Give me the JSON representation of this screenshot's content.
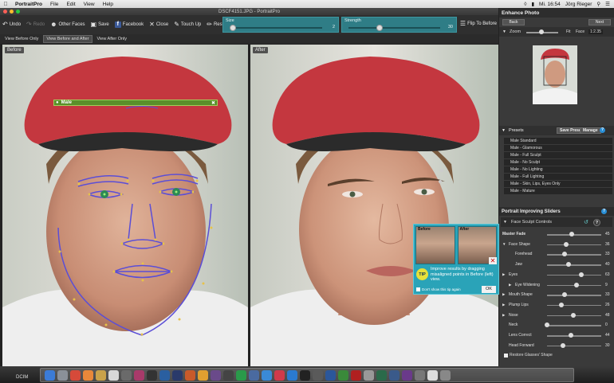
{
  "menubar": {
    "app": "PortraitPro",
    "menus": [
      "File",
      "Edit",
      "View",
      "Help"
    ],
    "clock": "Mi. 16:54",
    "user": "Jörg Rieger"
  },
  "window": {
    "title": "DSCF4151.JPG - PortraitPro"
  },
  "toolbar": {
    "undo": "Undo",
    "redo": "Redo",
    "other_faces": "Other Faces",
    "save": "Save",
    "facebook": "Facebook",
    "close": "Close",
    "touch_up": "Touch Up",
    "restore": "Restore",
    "size": {
      "label": "Size",
      "value": "2",
      "fraction": 0.03
    },
    "strength": {
      "label": "Strength",
      "value": "30",
      "fraction": 0.33
    },
    "flip": "Flip To Before"
  },
  "view_tabs": [
    "View Before Only",
    "View Before and After",
    "View After Only"
  ],
  "view_tab_active": 1,
  "before_label": "Before",
  "after_label": "After",
  "face_label": "Male",
  "tip": {
    "before": "Before",
    "after": "After",
    "badge": "TIP",
    "message": "Improve results by dragging misaligned points in Before (left) view.",
    "dont_show": "Don't show this tip again",
    "ok": "OK"
  },
  "enhance": {
    "title": "Enhance Photo",
    "back": "Back",
    "next": "Next",
    "zoom_label": "Zoom",
    "fit": "Fit",
    "face": "Face",
    "zoom_value": "1:2.35"
  },
  "presets": {
    "title": "Presets",
    "save": "Save Preset",
    "manage": "Manage",
    "items": [
      "Male Standard",
      "Male - Glamorous",
      "Male - Full Sculpt",
      "Male - No Sculpt",
      "Male - No Lighting",
      "Male - Full Lighting",
      "Male - Skin, Lips, Eyes Only",
      "Male - Mature"
    ]
  },
  "sliders": {
    "title": "Portrait Improving Sliders",
    "group": "Face Sculpt Controls",
    "restore_glasses": "Restore Glasses' Shape",
    "rows": [
      {
        "name": "Master Fade",
        "value": "45",
        "fraction": 0.45
      },
      {
        "name": "Face Shape",
        "value": "36",
        "fraction": 0.36
      },
      {
        "name": "Forehead",
        "value": "33",
        "fraction": 0.33
      },
      {
        "name": "Jaw",
        "value": "40",
        "fraction": 0.4
      },
      {
        "name": "Eyes",
        "value": "63",
        "fraction": 0.63
      },
      {
        "name": "Eye Widening",
        "value": "9",
        "fraction": 0.54
      },
      {
        "name": "Mouth Shape",
        "value": "33",
        "fraction": 0.33
      },
      {
        "name": "Plump Lips",
        "value": "26",
        "fraction": 0.26
      },
      {
        "name": "Nose",
        "value": "48",
        "fraction": 0.48
      },
      {
        "name": "Neck",
        "value": "0",
        "fraction": 0.0
      },
      {
        "name": "Lens Correct",
        "value": "44",
        "fraction": 0.44
      },
      {
        "name": "Head Forward",
        "value": "30",
        "fraction": 0.3
      }
    ]
  },
  "dock": {
    "label": "DCIM"
  }
}
